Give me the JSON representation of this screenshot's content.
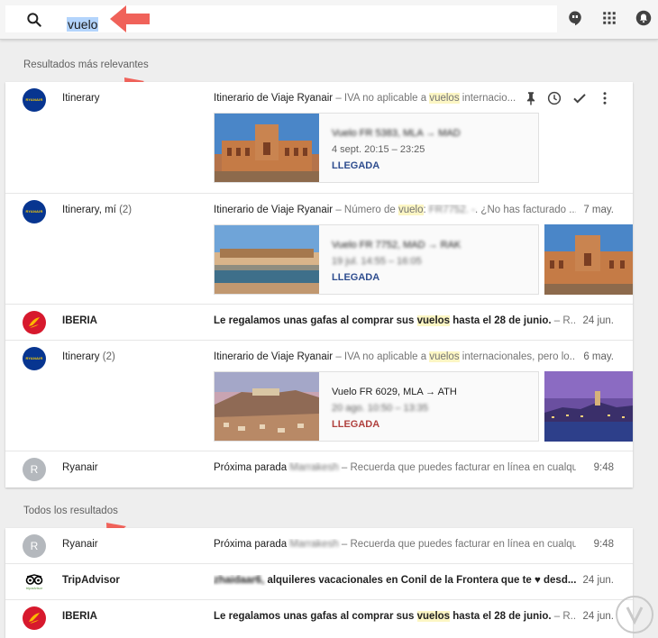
{
  "search": {
    "query": "vuelo"
  },
  "sections": {
    "relevant_title": "Resultados más relevantes",
    "all_title": "Todos los resultados"
  },
  "rows": [
    {
      "sender": "Itinerary",
      "count": "",
      "subject": "Itinerario de Viaje Ryanair",
      "snippet_pre": " – IVA no aplicable a ",
      "keyword": "vuelos",
      "snippet_post": " internacio...",
      "date": "",
      "card": {
        "line1": "Vuelo FR 5383, MLA → MAD",
        "line2": "4 sept. 20:15 – 23:25",
        "status": "LLEGADA"
      }
    },
    {
      "sender": "Itinerary, mí",
      "count": "(2)",
      "subject": "Itinerario de Viaje Ryanair",
      "snippet_pre": " – Número de ",
      "keyword": "vuelo",
      "snippet_mid": ": ",
      "blurred": "FR7752. -",
      "snippet_post": ". ¿No has facturado ...",
      "date": "7 may.",
      "card": {
        "line1": "Vuelo FR 7752, MAD → RAK",
        "line2": "19 jul. 14:55 – 16:05",
        "status": "LLEGADA"
      }
    },
    {
      "sender": "IBERIA",
      "subject": "Le regalamos unas gafas al comprar sus ",
      "keyword": "vuelos",
      "subject_post": " hasta el 28 de junio.",
      "snippet_post": " – R...",
      "date": "24 jun."
    },
    {
      "sender": "Itinerary",
      "count": "(2)",
      "subject": "Itinerario de Viaje Ryanair",
      "snippet_pre": " – IVA no aplicable a ",
      "keyword": "vuelos",
      "snippet_post": " internacionales, pero lo...",
      "date": "6 may.",
      "card": {
        "line1": "Vuelo FR 6029, MLA → ATH",
        "line2": "20 ago. 10:50 – 13:35",
        "status": "LLEGADA"
      }
    },
    {
      "sender": "Ryanair",
      "avatar_letter": "R",
      "subject": "Próxima parada",
      "blurred": "Marrakesh",
      "snippet_post": " – Recuerda que puedes facturar en línea en cualqui...",
      "date": "9:48"
    }
  ],
  "all_rows": [
    {
      "sender": "Ryanair",
      "avatar_letter": "R",
      "subject": "Próxima parada",
      "blurred": "Marrakesh",
      "snippet_post": " – Recuerda que puedes facturar en línea en cualqui...",
      "date": "9:48"
    },
    {
      "sender": "TripAdvisor",
      "blurred": "zhaidaar6,",
      "subject": " alquileres vacacionales en Conil de la Frontera que te ♥ desd...",
      "date": "24 jun."
    },
    {
      "sender": "IBERIA",
      "subject": "Le regalamos unas gafas al comprar sus ",
      "keyword": "vuelos",
      "subject_post": " hasta el 28 de junio.",
      "snippet_post": " – R...",
      "date": "24 jun."
    }
  ],
  "brand": {
    "ryanair_logo_text": "RYANAIR",
    "tripadvisor_logo_text": "tripadvisor"
  },
  "colors": {
    "accent_arrow": "#f0625a",
    "ryanair_blue": "#073590",
    "iberia_red": "#d7192d",
    "highlight": "#fcf6c4",
    "status_blue": "#2e4d8f",
    "status_red": "#b0413e"
  },
  "icons": [
    "search-icon",
    "hangouts-icon",
    "apps-grid-icon",
    "notifications-icon",
    "pin-icon",
    "snooze-clock-icon",
    "done-check-icon",
    "more-vert-icon"
  ]
}
